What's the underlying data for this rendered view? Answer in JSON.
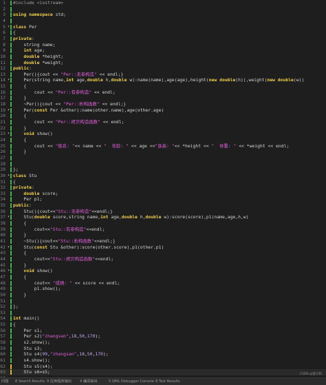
{
  "lines": [
    {
      "n": "1",
      "fold": "",
      "mark": "green",
      "segs": [
        [
          "pp",
          "#include <iostream>"
        ]
      ]
    },
    {
      "n": "2",
      "fold": "",
      "mark": "green",
      "segs": []
    },
    {
      "n": "3",
      "fold": "",
      "mark": "green",
      "segs": [
        [
          "kw",
          "using namespace"
        ],
        [
          "pl",
          " std;"
        ]
      ]
    },
    {
      "n": "4",
      "fold": "",
      "mark": "green",
      "segs": []
    },
    {
      "n": "5",
      "fold": "▾",
      "mark": "green",
      "segs": [
        [
          "kw",
          "class"
        ],
        [
          "pl",
          " Per"
        ]
      ]
    },
    {
      "n": "6",
      "fold": "",
      "mark": "green",
      "segs": [
        [
          "pl",
          "{"
        ]
      ]
    },
    {
      "n": "7",
      "fold": "",
      "mark": "green",
      "segs": [
        [
          "kw",
          "private"
        ],
        [
          "pl",
          ":"
        ]
      ]
    },
    {
      "n": "8",
      "fold": "",
      "mark": "green",
      "segs": [
        [
          "pl",
          "    string name;"
        ]
      ]
    },
    {
      "n": "9",
      "fold": "",
      "mark": "green",
      "segs": [
        [
          "pl",
          "    "
        ],
        [
          "kw",
          "int"
        ],
        [
          "pl",
          " age;"
        ]
      ]
    },
    {
      "n": "10",
      "fold": "",
      "mark": "green",
      "segs": [
        [
          "pl",
          "    "
        ],
        [
          "kw",
          "double"
        ],
        [
          "pl",
          " *height;"
        ]
      ]
    },
    {
      "n": "11",
      "fold": "",
      "mark": "green",
      "segs": [
        [
          "pl",
          "    "
        ],
        [
          "kw",
          "double"
        ],
        [
          "pl",
          " *weight;"
        ]
      ]
    },
    {
      "n": "12",
      "fold": "",
      "mark": "green",
      "segs": [
        [
          "kw",
          "public"
        ],
        [
          "pl",
          ":"
        ]
      ]
    },
    {
      "n": "13",
      "fold": "",
      "mark": "green",
      "segs": [
        [
          "pl",
          "    Per(){cout << "
        ],
        [
          "str",
          "\"Per::无参构造\""
        ],
        [
          "pl",
          " << endl;}"
        ]
      ]
    },
    {
      "n": "14",
      "fold": "▾",
      "mark": "green",
      "segs": [
        [
          "pl",
          "    Per(string name,"
        ],
        [
          "kw",
          "int"
        ],
        [
          "pl",
          " age,"
        ],
        [
          "kw",
          "double"
        ],
        [
          "pl",
          " h,"
        ],
        [
          "kw",
          "double"
        ],
        [
          "pl",
          " w):name(name),age(age),height("
        ],
        [
          "kw",
          "new double"
        ],
        [
          "pl",
          "(h)),weight("
        ],
        [
          "kw",
          "new double"
        ],
        [
          "pl",
          "(w))"
        ]
      ]
    },
    {
      "n": "15",
      "fold": "",
      "mark": "green",
      "segs": [
        [
          "pl",
          "    {"
        ]
      ]
    },
    {
      "n": "16",
      "fold": "",
      "mark": "green",
      "segs": [
        [
          "pl",
          "        cout << "
        ],
        [
          "str",
          "\"Per::有参构造\""
        ],
        [
          "pl",
          " << endl;"
        ]
      ]
    },
    {
      "n": "17",
      "fold": "",
      "mark": "green",
      "segs": [
        [
          "pl",
          "    }"
        ]
      ]
    },
    {
      "n": "18",
      "fold": "",
      "mark": "green",
      "segs": [
        [
          "pl",
          "    ~Per(){cout << "
        ],
        [
          "str",
          "\"Per::析构函数\""
        ],
        [
          "pl",
          " << endl;}"
        ]
      ]
    },
    {
      "n": "19",
      "fold": "▾",
      "mark": "green",
      "segs": [
        [
          "pl",
          "    Per("
        ],
        [
          "kw",
          "const"
        ],
        [
          "pl",
          " Per &other):name(other.name),age(other.age)"
        ]
      ]
    },
    {
      "n": "20",
      "fold": "",
      "mark": "green",
      "segs": [
        [
          "pl",
          "    {"
        ]
      ]
    },
    {
      "n": "21",
      "fold": "",
      "mark": "green",
      "segs": [
        [
          "pl",
          "        cout << "
        ],
        [
          "str",
          "\"Per::拷贝构造函数\""
        ],
        [
          "pl",
          " << endl;"
        ]
      ]
    },
    {
      "n": "22",
      "fold": "",
      "mark": "green",
      "segs": [
        [
          "pl",
          "    }"
        ]
      ]
    },
    {
      "n": "23",
      "fold": "▾",
      "mark": "green",
      "segs": [
        [
          "pl",
          "    "
        ],
        [
          "kw",
          "void"
        ],
        [
          "pl",
          " show()"
        ]
      ]
    },
    {
      "n": "24",
      "fold": "",
      "mark": "green",
      "segs": [
        [
          "pl",
          "    {"
        ]
      ]
    },
    {
      "n": "25",
      "fold": "",
      "mark": "green",
      "segs": [
        [
          "pl",
          "        cout << "
        ],
        [
          "str",
          "\"姓名: \""
        ],
        [
          "pl",
          "<< name << "
        ],
        [
          "str",
          "\"  年龄: \""
        ],
        [
          "pl",
          " << age <<"
        ],
        [
          "str",
          "\"身高: \""
        ],
        [
          "pl",
          "<< *height << "
        ],
        [
          "str",
          "\"  体重: \""
        ],
        [
          "pl",
          " << *weight << endl;"
        ]
      ]
    },
    {
      "n": "26",
      "fold": "",
      "mark": "green",
      "segs": [
        [
          "pl",
          "    }"
        ]
      ]
    },
    {
      "n": "27",
      "fold": "",
      "mark": "green",
      "segs": []
    },
    {
      "n": "28",
      "fold": "",
      "mark": "green",
      "segs": []
    },
    {
      "n": "29",
      "fold": "",
      "mark": "green",
      "segs": [
        [
          "pl",
          "};"
        ]
      ]
    },
    {
      "n": "30",
      "fold": "▾",
      "mark": "green",
      "segs": [
        [
          "kw",
          "class"
        ],
        [
          "pl",
          " Stu"
        ]
      ]
    },
    {
      "n": "31",
      "fold": "",
      "mark": "green",
      "segs": [
        [
          "pl",
          "{"
        ]
      ]
    },
    {
      "n": "32",
      "fold": "",
      "mark": "green",
      "segs": [
        [
          "kw",
          "private"
        ],
        [
          "pl",
          ":"
        ]
      ]
    },
    {
      "n": "33",
      "fold": "",
      "mark": "green",
      "segs": [
        [
          "pl",
          "    "
        ],
        [
          "kw",
          "double"
        ],
        [
          "pl",
          " score;"
        ]
      ]
    },
    {
      "n": "34",
      "fold": "",
      "mark": "green",
      "segs": [
        [
          "pl",
          "    Per p1;"
        ]
      ]
    },
    {
      "n": "35",
      "fold": "",
      "mark": "green",
      "segs": [
        [
          "kw",
          "public"
        ],
        [
          "pl",
          ":"
        ]
      ]
    },
    {
      "n": "36",
      "fold": "",
      "mark": "green",
      "segs": [
        [
          "pl",
          "    Stu(){cout<<"
        ],
        [
          "str",
          "\"Stu::无参构造\""
        ],
        [
          "pl",
          "<<endl;}"
        ]
      ]
    },
    {
      "n": "37",
      "fold": "▾",
      "mark": "green",
      "segs": [
        [
          "pl",
          "    Stu("
        ],
        [
          "kw",
          "double"
        ],
        [
          "pl",
          " score,string name,"
        ],
        [
          "kw",
          "int"
        ],
        [
          "pl",
          " age,"
        ],
        [
          "kw",
          "double"
        ],
        [
          "pl",
          " h,"
        ],
        [
          "kw",
          "double"
        ],
        [
          "pl",
          " w):score(score),p1(name,age,h,w)"
        ]
      ]
    },
    {
      "n": "38",
      "fold": "",
      "mark": "green",
      "segs": [
        [
          "pl",
          "    {"
        ]
      ]
    },
    {
      "n": "39",
      "fold": "",
      "mark": "green",
      "segs": [
        [
          "pl",
          "        cout<<"
        ],
        [
          "str",
          "\"Stu::有参构造\""
        ],
        [
          "pl",
          "<<endl;"
        ]
      ]
    },
    {
      "n": "40",
      "fold": "",
      "mark": "green",
      "segs": [
        [
          "pl",
          "    }"
        ]
      ]
    },
    {
      "n": "41",
      "fold": "",
      "mark": "green",
      "segs": [
        [
          "pl",
          "    ~Stu(){cout<<"
        ],
        [
          "str",
          "\"Stu::析构函数\""
        ],
        [
          "pl",
          "<<endl;}"
        ]
      ]
    },
    {
      "n": "42",
      "fold": "▾",
      "mark": "green",
      "segs": [
        [
          "pl",
          "    Stu("
        ],
        [
          "kw",
          "const"
        ],
        [
          "pl",
          " Stu &other):score(other.score),p1(other.p1)"
        ]
      ]
    },
    {
      "n": "43",
      "fold": "",
      "mark": "green",
      "segs": [
        [
          "pl",
          "    {"
        ]
      ]
    },
    {
      "n": "44",
      "fold": "",
      "mark": "green",
      "segs": [
        [
          "pl",
          "        cout<<"
        ],
        [
          "str",
          "\"Stu::拷贝构造函数\""
        ],
        [
          "pl",
          "<<endl;"
        ]
      ]
    },
    {
      "n": "45",
      "fold": "",
      "mark": "green",
      "segs": [
        [
          "pl",
          "    }"
        ]
      ]
    },
    {
      "n": "46",
      "fold": "▾",
      "mark": "green",
      "segs": [
        [
          "pl",
          "    "
        ],
        [
          "kw",
          "void"
        ],
        [
          "pl",
          " show()"
        ]
      ]
    },
    {
      "n": "47",
      "fold": "",
      "mark": "green",
      "segs": [
        [
          "pl",
          "    {"
        ]
      ]
    },
    {
      "n": "48",
      "fold": "",
      "mark": "green",
      "segs": [
        [
          "pl",
          "        cout<< "
        ],
        [
          "str",
          "\"成绩: \""
        ],
        [
          "pl",
          " << score << endl;"
        ]
      ]
    },
    {
      "n": "49",
      "fold": "",
      "mark": "green",
      "segs": [
        [
          "pl",
          "        p1.show();"
        ]
      ]
    },
    {
      "n": "50",
      "fold": "",
      "mark": "green",
      "segs": [
        [
          "pl",
          "    }"
        ]
      ]
    },
    {
      "n": "51",
      "fold": "",
      "mark": "green",
      "segs": []
    },
    {
      "n": "52",
      "fold": "",
      "mark": "green",
      "segs": [
        [
          "pl",
          "};"
        ]
      ]
    },
    {
      "n": "53",
      "fold": "",
      "mark": "green",
      "segs": []
    },
    {
      "n": "54",
      "fold": "",
      "mark": "green",
      "segs": [
        [
          "kw",
          "int"
        ],
        [
          "pl",
          " main()"
        ]
      ]
    },
    {
      "n": "55",
      "fold": "",
      "mark": "green",
      "segs": [
        [
          "pl",
          "{"
        ]
      ]
    },
    {
      "n": "56",
      "fold": "",
      "mark": "green",
      "segs": [
        [
          "pl",
          "    Per s1;"
        ]
      ]
    },
    {
      "n": "57",
      "fold": "",
      "mark": "green",
      "segs": [
        [
          "pl",
          "    Per s2("
        ],
        [
          "str",
          "\"zhangsan\""
        ],
        [
          "pl",
          ","
        ],
        [
          "num",
          "18"
        ],
        [
          "pl",
          ","
        ],
        [
          "num",
          "50"
        ],
        [
          "pl",
          ","
        ],
        [
          "num",
          "170"
        ],
        [
          "pl",
          ");"
        ]
      ]
    },
    {
      "n": "58",
      "fold": "",
      "mark": "green",
      "segs": [
        [
          "pl",
          "    s2.show();"
        ]
      ]
    },
    {
      "n": "59",
      "fold": "",
      "mark": "green",
      "segs": [
        [
          "pl",
          "    Stu s3;"
        ]
      ]
    },
    {
      "n": "60",
      "fold": "",
      "mark": "green",
      "segs": [
        [
          "pl",
          "    Stu s4("
        ],
        [
          "num",
          "99"
        ],
        [
          "pl",
          ","
        ],
        [
          "str",
          "\"zhangsan\""
        ],
        [
          "pl",
          ","
        ],
        [
          "num",
          "18"
        ],
        [
          "pl",
          ","
        ],
        [
          "num",
          "50"
        ],
        [
          "pl",
          ","
        ],
        [
          "num",
          "170"
        ],
        [
          "pl",
          ");"
        ]
      ]
    },
    {
      "n": "61",
      "fold": "",
      "mark": "green",
      "segs": [
        [
          "pl",
          "    s4.show();"
        ]
      ]
    },
    {
      "n": "62",
      "fold": "",
      "mark": "yellow",
      "segs": [
        [
          "pl",
          "    Stu s5(s4);"
        ]
      ]
    },
    {
      "n": "63",
      "fold": "",
      "mark": "yellow",
      "segs": [
        [
          "pl",
          "    Stu s6=s5;"
        ]
      ]
    },
    {
      "n": "64",
      "fold": "",
      "mark": "",
      "segs": []
    },
    {
      "n": "65",
      "fold": "",
      "mark": "",
      "segs": [
        [
          "pl",
          "    "
        ],
        [
          "kw",
          "return"
        ],
        [
          "pl",
          " "
        ],
        [
          "num",
          "0"
        ],
        [
          "pl",
          ";"
        ]
      ]
    },
    {
      "n": "66",
      "fold": "",
      "mark": "",
      "segs": [
        [
          "pl",
          "}"
        ]
      ]
    }
  ],
  "current_line": 63,
  "status_tabs": [
    "问题",
    "8 Search Results",
    "9 应用程序输出",
    "4 编译输出",
    "5 QML Debugger Console",
    "8 Test Results"
  ],
  "watermark": "CSDN @蛋小狗"
}
